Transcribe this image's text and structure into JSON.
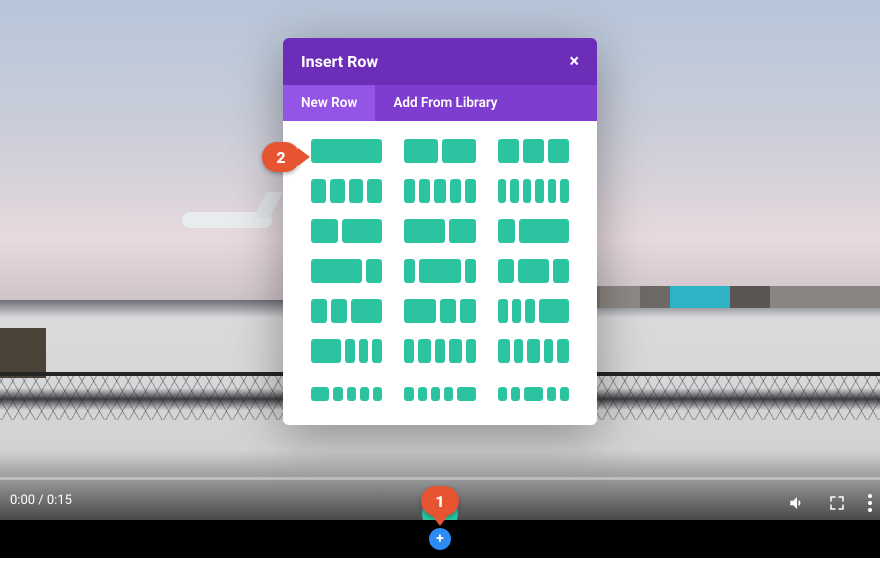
{
  "video": {
    "time_display": "0:00 / 0:15"
  },
  "modal": {
    "title": "Insert Row",
    "tabs": {
      "new_row": "New Row",
      "library": "Add From Library"
    }
  },
  "annotations": {
    "one": "1",
    "two": "2"
  },
  "icons": {
    "close": "×",
    "plus": "+",
    "plus_small": "+"
  },
  "colors": {
    "brand_purple": "#6c2eb9",
    "teal": "#2bc3a0",
    "orange": "#e75431",
    "blue": "#2d8bf5"
  }
}
